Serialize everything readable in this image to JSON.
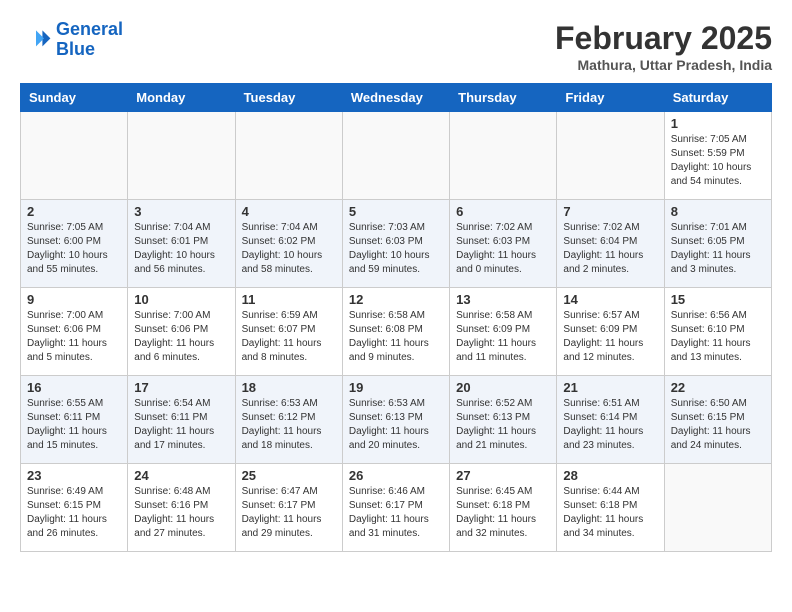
{
  "logo": {
    "line1": "General",
    "line2": "Blue"
  },
  "title": "February 2025",
  "location": "Mathura, Uttar Pradesh, India",
  "days_of_week": [
    "Sunday",
    "Monday",
    "Tuesday",
    "Wednesday",
    "Thursday",
    "Friday",
    "Saturday"
  ],
  "weeks": [
    {
      "stripe": false,
      "days": [
        {
          "num": "",
          "info": ""
        },
        {
          "num": "",
          "info": ""
        },
        {
          "num": "",
          "info": ""
        },
        {
          "num": "",
          "info": ""
        },
        {
          "num": "",
          "info": ""
        },
        {
          "num": "",
          "info": ""
        },
        {
          "num": "1",
          "info": "Sunrise: 7:05 AM\nSunset: 5:59 PM\nDaylight: 10 hours\nand 54 minutes."
        }
      ]
    },
    {
      "stripe": true,
      "days": [
        {
          "num": "2",
          "info": "Sunrise: 7:05 AM\nSunset: 6:00 PM\nDaylight: 10 hours\nand 55 minutes."
        },
        {
          "num": "3",
          "info": "Sunrise: 7:04 AM\nSunset: 6:01 PM\nDaylight: 10 hours\nand 56 minutes."
        },
        {
          "num": "4",
          "info": "Sunrise: 7:04 AM\nSunset: 6:02 PM\nDaylight: 10 hours\nand 58 minutes."
        },
        {
          "num": "5",
          "info": "Sunrise: 7:03 AM\nSunset: 6:03 PM\nDaylight: 10 hours\nand 59 minutes."
        },
        {
          "num": "6",
          "info": "Sunrise: 7:02 AM\nSunset: 6:03 PM\nDaylight: 11 hours\nand 0 minutes."
        },
        {
          "num": "7",
          "info": "Sunrise: 7:02 AM\nSunset: 6:04 PM\nDaylight: 11 hours\nand 2 minutes."
        },
        {
          "num": "8",
          "info": "Sunrise: 7:01 AM\nSunset: 6:05 PM\nDaylight: 11 hours\nand 3 minutes."
        }
      ]
    },
    {
      "stripe": false,
      "days": [
        {
          "num": "9",
          "info": "Sunrise: 7:00 AM\nSunset: 6:06 PM\nDaylight: 11 hours\nand 5 minutes."
        },
        {
          "num": "10",
          "info": "Sunrise: 7:00 AM\nSunset: 6:06 PM\nDaylight: 11 hours\nand 6 minutes."
        },
        {
          "num": "11",
          "info": "Sunrise: 6:59 AM\nSunset: 6:07 PM\nDaylight: 11 hours\nand 8 minutes."
        },
        {
          "num": "12",
          "info": "Sunrise: 6:58 AM\nSunset: 6:08 PM\nDaylight: 11 hours\nand 9 minutes."
        },
        {
          "num": "13",
          "info": "Sunrise: 6:58 AM\nSunset: 6:09 PM\nDaylight: 11 hours\nand 11 minutes."
        },
        {
          "num": "14",
          "info": "Sunrise: 6:57 AM\nSunset: 6:09 PM\nDaylight: 11 hours\nand 12 minutes."
        },
        {
          "num": "15",
          "info": "Sunrise: 6:56 AM\nSunset: 6:10 PM\nDaylight: 11 hours\nand 13 minutes."
        }
      ]
    },
    {
      "stripe": true,
      "days": [
        {
          "num": "16",
          "info": "Sunrise: 6:55 AM\nSunset: 6:11 PM\nDaylight: 11 hours\nand 15 minutes."
        },
        {
          "num": "17",
          "info": "Sunrise: 6:54 AM\nSunset: 6:11 PM\nDaylight: 11 hours\nand 17 minutes."
        },
        {
          "num": "18",
          "info": "Sunrise: 6:53 AM\nSunset: 6:12 PM\nDaylight: 11 hours\nand 18 minutes."
        },
        {
          "num": "19",
          "info": "Sunrise: 6:53 AM\nSunset: 6:13 PM\nDaylight: 11 hours\nand 20 minutes."
        },
        {
          "num": "20",
          "info": "Sunrise: 6:52 AM\nSunset: 6:13 PM\nDaylight: 11 hours\nand 21 minutes."
        },
        {
          "num": "21",
          "info": "Sunrise: 6:51 AM\nSunset: 6:14 PM\nDaylight: 11 hours\nand 23 minutes."
        },
        {
          "num": "22",
          "info": "Sunrise: 6:50 AM\nSunset: 6:15 PM\nDaylight: 11 hours\nand 24 minutes."
        }
      ]
    },
    {
      "stripe": false,
      "days": [
        {
          "num": "23",
          "info": "Sunrise: 6:49 AM\nSunset: 6:15 PM\nDaylight: 11 hours\nand 26 minutes."
        },
        {
          "num": "24",
          "info": "Sunrise: 6:48 AM\nSunset: 6:16 PM\nDaylight: 11 hours\nand 27 minutes."
        },
        {
          "num": "25",
          "info": "Sunrise: 6:47 AM\nSunset: 6:17 PM\nDaylight: 11 hours\nand 29 minutes."
        },
        {
          "num": "26",
          "info": "Sunrise: 6:46 AM\nSunset: 6:17 PM\nDaylight: 11 hours\nand 31 minutes."
        },
        {
          "num": "27",
          "info": "Sunrise: 6:45 AM\nSunset: 6:18 PM\nDaylight: 11 hours\nand 32 minutes."
        },
        {
          "num": "28",
          "info": "Sunrise: 6:44 AM\nSunset: 6:18 PM\nDaylight: 11 hours\nand 34 minutes."
        },
        {
          "num": "",
          "info": ""
        }
      ]
    }
  ]
}
